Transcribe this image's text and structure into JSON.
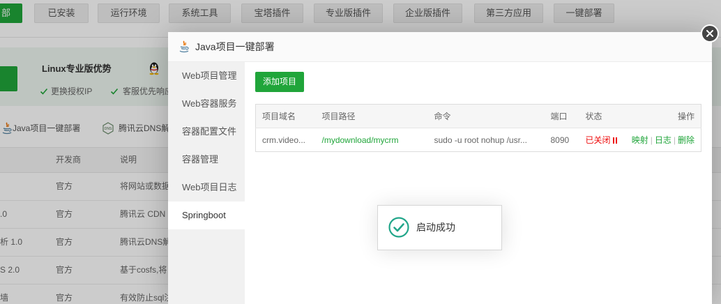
{
  "colors": {
    "brand_green": "#20a53a",
    "status_stopped_red": "#ee0a0a",
    "toast_icon_green": "#22a68a"
  },
  "background": {
    "tabs": [
      {
        "label": "部",
        "active": true
      },
      {
        "label": "已安装",
        "active": false
      },
      {
        "label": "运行环境",
        "active": false
      },
      {
        "label": "系统工具",
        "active": false
      },
      {
        "label": "宝塔插件",
        "active": false
      },
      {
        "label": "专业版插件",
        "active": false
      },
      {
        "label": "企业版插件",
        "active": false
      },
      {
        "label": "第三方应用",
        "active": false
      },
      {
        "label": "一键部署",
        "active": false
      }
    ],
    "pro_banner": {
      "title": "Linux专业版优势",
      "benefits": [
        "更换授权IP",
        "客服优先响应"
      ]
    },
    "quick_access": [
      {
        "icon": "java-icon",
        "label": "Java项目一键部署"
      },
      {
        "icon": "dns-icon",
        "icon_text": "DNS",
        "label": "腾讯云DNS解"
      }
    ],
    "table": {
      "headers": {
        "developer": "开发商",
        "description": "说明"
      },
      "rows": [
        {
          "developer": "官方",
          "description": "将网站或数据"
        },
        {
          "name": ".0",
          "developer": "官方",
          "description": "腾讯云 CDN"
        },
        {
          "name": "析 1.0",
          "developer": "官方",
          "description": "腾讯云DNS解"
        },
        {
          "name": "S 2.0",
          "developer": "官方",
          "description": "基于cosfs,将"
        },
        {
          "name": "墙",
          "developer": "官方",
          "description": "有效防止sql注"
        }
      ]
    }
  },
  "modal": {
    "title": "Java项目一键部署",
    "title_icon": "java-icon",
    "close_icon": "close-icon",
    "sidebar": [
      {
        "label": "Web项目管理",
        "active": false
      },
      {
        "label": "Web容器服务",
        "active": false
      },
      {
        "label": "容器配置文件",
        "active": false
      },
      {
        "label": "容器管理",
        "active": false
      },
      {
        "label": "Web项目日志",
        "active": false
      },
      {
        "label": "Springboot",
        "active": true
      }
    ],
    "add_button": "添加项目",
    "table": {
      "headers": {
        "domain": "项目域名",
        "path": "项目路径",
        "command": "命令",
        "port": "端口",
        "status": "状态",
        "actions": "操作"
      },
      "rows": [
        {
          "domain": "crm.video...",
          "path": "/mydownload/mycrm",
          "command": "sudo -u root nohup /usr...",
          "port": "8090",
          "status": "已关闭",
          "status_icon": "pause-icon",
          "actions": [
            "映射",
            "日志",
            "删除"
          ],
          "separator": "|"
        }
      ]
    }
  },
  "toast": {
    "icon": "success-check-icon",
    "message": "启动成功"
  }
}
